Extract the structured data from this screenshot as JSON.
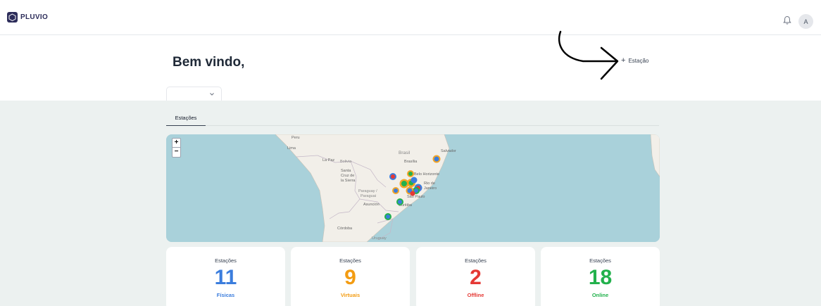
{
  "app": {
    "brand": "PLUVIO"
  },
  "header": {
    "avatar_initial": "A"
  },
  "main": {
    "welcome": "Bem vindo,",
    "add_station_label": "Estação",
    "tabs": [
      {
        "label": "Estações",
        "active": true
      }
    ]
  },
  "map": {
    "zoom_in": "+",
    "zoom_out": "−",
    "labels": {
      "peru": "Peru",
      "lima": "Lima",
      "brasil": "Brasil",
      "salvador": "Salvador",
      "la_paz": "La Paz",
      "bolivia": "Bolivia",
      "brasilia": "Brasília",
      "santa_cruz": [
        "Santa",
        "Cruz de",
        "la Sierra"
      ],
      "belo_horizonte": "Belo Horizonte",
      "rio": [
        "Rio de",
        "Janeiro"
      ],
      "paraguay": [
        "Paraguay /",
        "Paraguai"
      ],
      "asuncion": "Asunción",
      "sao_paulo": "São Paulo",
      "curitiba": "Curitiba",
      "cordoba": "Córdoba",
      "uruguay": "Uruguay"
    }
  },
  "stats": [
    {
      "label": "Estações",
      "value": "11",
      "sub": "Físicas",
      "color": "#3b7ddd"
    },
    {
      "label": "Estações",
      "value": "9",
      "sub": "Virtuais",
      "color": "#f39c12"
    },
    {
      "label": "Estações",
      "value": "2",
      "sub": "Offline",
      "color": "#e53935"
    },
    {
      "label": "Estações",
      "value": "18",
      "sub": "Online",
      "color": "#22b14c"
    }
  ],
  "colors": {
    "brand": "#2d2d5a",
    "background": "#ecf1f0",
    "map_water": "#a9d1da",
    "map_land": "#f2efe9"
  },
  "icons": {
    "bell": "bell-icon",
    "plus": "plus-icon",
    "chevron": "chevron-down-icon",
    "logo": "pluvio-logo-icon"
  }
}
